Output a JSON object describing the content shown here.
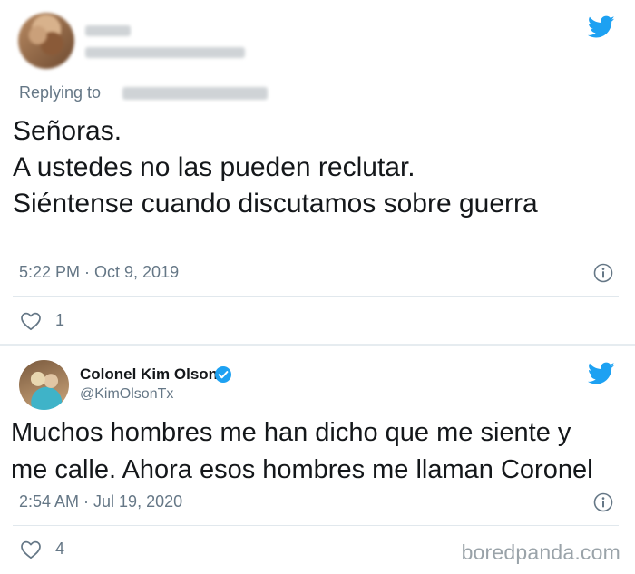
{
  "tweets": [
    {
      "replying_label": "Replying to",
      "body_lines": [
        "Señoras.",
        "A ustedes no las pueden reclutar.",
        "Siéntense cuando discutamos sobre guerra"
      ],
      "timestamp": "5:22 PM · Oct 9, 2019",
      "likes": "1"
    },
    {
      "author_name": "Colonel Kim Olson",
      "author_handle": "@KimOlsonTx",
      "body_lines": [
        "Muchos hombres me han dicho que me siente y",
        "me calle. Ahora esos hombres me llaman Coronel"
      ],
      "timestamp": "2:54 AM · Jul 19, 2020",
      "likes": "4"
    }
  ],
  "watermark": "boredpanda.com",
  "colors": {
    "twitter_blue": "#1da1f2",
    "secondary_text": "#657786",
    "primary_text": "#14171a"
  },
  "icons": [
    "twitter-bird-icon",
    "info-icon",
    "heart-icon",
    "verified-badge-icon"
  ]
}
